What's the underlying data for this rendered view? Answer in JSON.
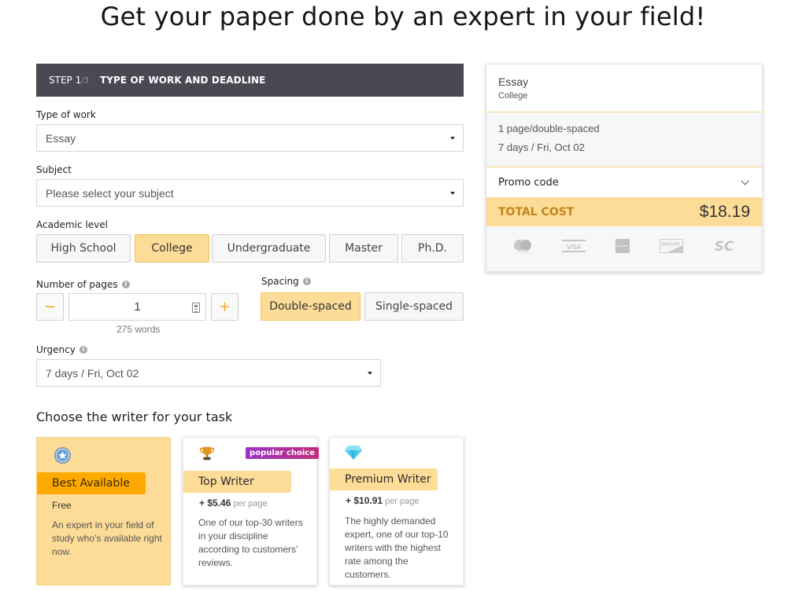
{
  "headline": "Get your paper done by an expert in your field!",
  "form": {
    "step_label": "STEP 1",
    "step_total": "/3",
    "step_title": "TYPE OF WORK AND DEADLINE",
    "type_of_work": {
      "label": "Type of work",
      "value": "Essay"
    },
    "subject": {
      "label": "Subject",
      "placeholder": "Please select your subject"
    },
    "academic_level": {
      "label": "Academic level",
      "options": [
        "High School",
        "College",
        "Undergraduate",
        "Master",
        "Ph.D."
      ],
      "selected": "College"
    },
    "pages": {
      "label": "Number of pages",
      "value": "1",
      "words": "275 words",
      "minus": "−",
      "plus": "+"
    },
    "spacing": {
      "label": "Spacing",
      "options": [
        "Double-spaced",
        "Single-spaced"
      ],
      "selected": "Double-spaced"
    },
    "urgency": {
      "label": "Urgency",
      "value": "7 days / Fri, Oct 02"
    }
  },
  "writer": {
    "title": "Choose the writer for your task",
    "cards": [
      {
        "name": "Best Available",
        "icon": "star-badge-icon",
        "price": "Free",
        "per": "",
        "description": "An expert in your field of study who’s available right now.",
        "selected": true
      },
      {
        "name": "Top Writer",
        "icon": "trophy-icon",
        "price": "+ $5.46",
        "per": "per page",
        "badge": "popular choice",
        "description": "One of our top-30 writers in your discipline according to customers’ reviews.",
        "selected": false
      },
      {
        "name": "Premium Writer",
        "icon": "diamond-icon",
        "price": "+ $10.91",
        "per": "per page",
        "description": "The highly demanded expert, one of our top-10 writers with the highest rate among the customers.",
        "selected": false
      }
    ]
  },
  "summary": {
    "type": "Essay",
    "level": "College",
    "pages": "1 page/double-spaced",
    "deadline": "7 days / Fri, Oct 02",
    "promo_label": "Promo code",
    "total_label": "TOTAL COST",
    "total_value": "$18.19",
    "payment_methods": [
      "mastercard-icon",
      "visa-icon",
      "amex-icon",
      "discover-icon",
      "sc-icon"
    ],
    "visa_text": "VISA",
    "discover_text": "DISCOVER",
    "sc_text": "SC"
  },
  "colors": {
    "accent": "#fddc98",
    "accent_strong": "#ffaa00",
    "header_bar": "#4a4852",
    "total_label": "#c2851c",
    "badge": "#a23ac0"
  }
}
